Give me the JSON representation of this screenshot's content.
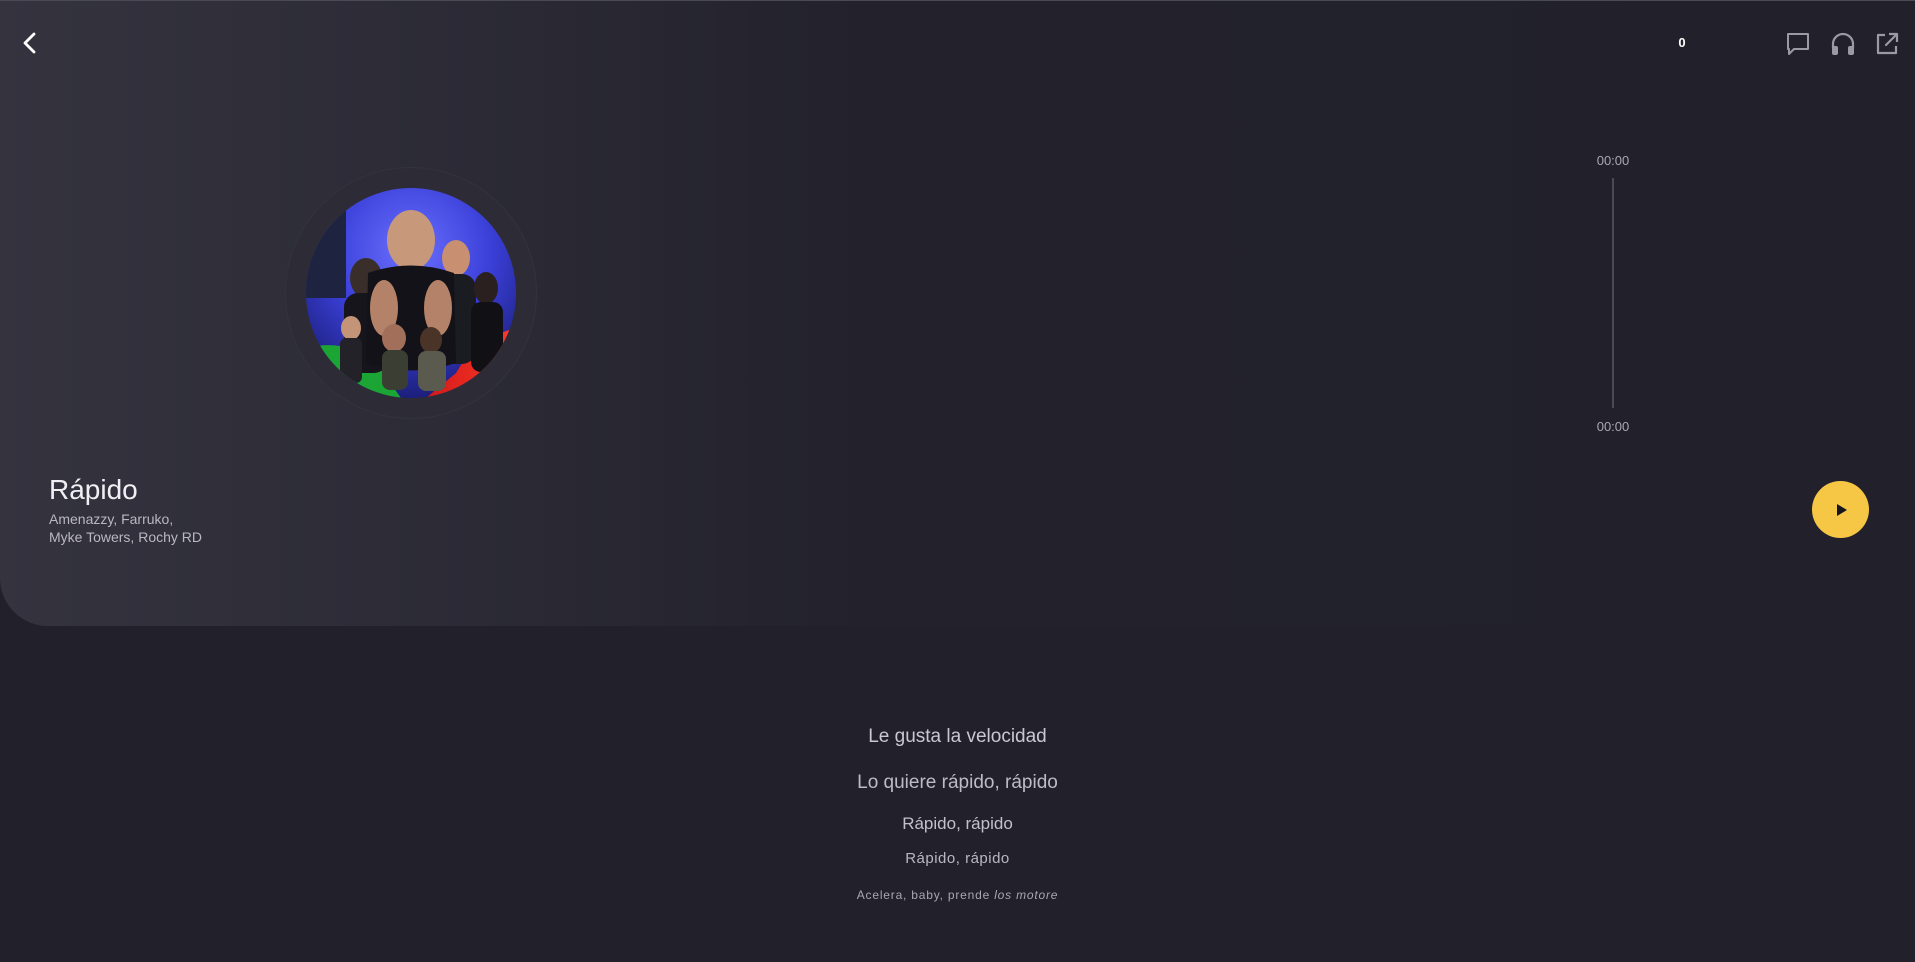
{
  "header": {
    "counter": "0"
  },
  "track": {
    "title": "Rápido",
    "artists_line1": "Amenazzy, Farruko,",
    "artists_line2": "Myke Towers, Rochy RD"
  },
  "player": {
    "elapsed": "00:00",
    "duration": "00:00",
    "progress": 0,
    "accent_color": "#f6c744"
  },
  "lyrics": {
    "line0": "Le gusta la velocidad",
    "line1": "Lo quiere rápido, rápido",
    "line2": "Rápido, rápido",
    "line3": "Rápido, rápido",
    "line4_a": "Acelera, baby, prende ",
    "line4_b": "los motore"
  },
  "icons": {
    "back": "chevron-left-icon",
    "comments": "chat-bubble-icon",
    "listen": "headphones-icon",
    "share": "external-link-icon",
    "play": "play-icon"
  }
}
